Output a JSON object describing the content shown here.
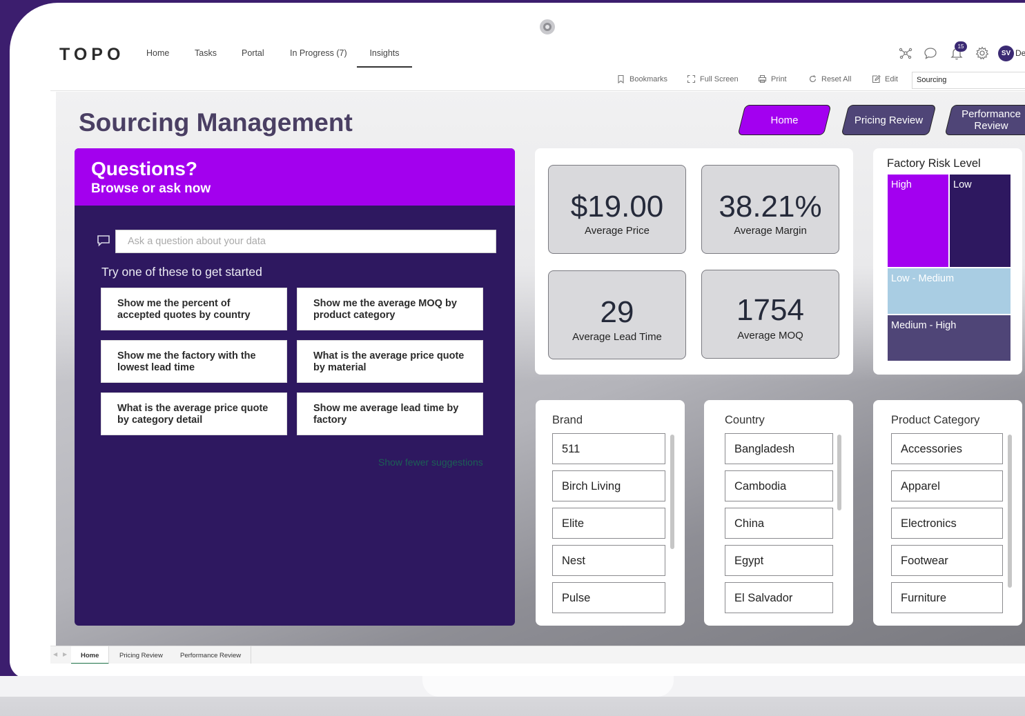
{
  "app": {
    "logo": "TOPO",
    "nav": [
      "Home",
      "Tasks",
      "Portal",
      "In Progress (7)",
      "Insights"
    ],
    "active_nav": "Insights",
    "notification_count": "15",
    "user_initials": "SV",
    "user_name_truncated": "De"
  },
  "toolbar": {
    "bookmarks": "Bookmarks",
    "full_screen": "Full Screen",
    "print": "Print",
    "reset_all": "Reset All",
    "edit": "Edit",
    "workspace": "Sourcing"
  },
  "report": {
    "title": "Sourcing Management",
    "nav_buttons": {
      "home": "Home",
      "pricing": "Pricing Review",
      "performance": "Performance Review"
    },
    "qa": {
      "title": "Questions?",
      "subtitle": "Browse or ask now",
      "input_placeholder": "Ask a question about your data",
      "try_label": "Try one of these to get started",
      "suggestions": [
        "Show me the percent of accepted quotes by country",
        "Show me the average MOQ by product category",
        "Show me the factory with the lowest lead time",
        "What is the average price quote by material",
        "What is the average price quote by category detail",
        "Show me average lead time by factory"
      ],
      "show_fewer": "Show fewer suggestions"
    },
    "kpis": [
      {
        "value": "$19.00",
        "label": "Average Price"
      },
      {
        "value": "38.21%",
        "label": "Average Margin"
      },
      {
        "value": "29",
        "label": "Average Lead Time"
      },
      {
        "value": "1754",
        "label": "Average MOQ"
      }
    ],
    "risk": {
      "title": "Factory Risk Level",
      "levels": [
        "High",
        "Low",
        "Low - Medium",
        "Medium - High"
      ],
      "colors": {
        "High": "#a300f0",
        "Low": "#2e1860",
        "Low - Medium": "#a9cde3",
        "Medium - High": "#4f4577"
      }
    },
    "slicers": {
      "brand": {
        "title": "Brand",
        "items": [
          "511",
          "Birch Living",
          "Elite",
          "Nest",
          "Pulse"
        ]
      },
      "country": {
        "title": "Country",
        "items": [
          "Bangladesh",
          "Cambodia",
          "China",
          "Egypt",
          "El Salvador"
        ]
      },
      "category": {
        "title": "Product Category",
        "items": [
          "Accessories",
          "Apparel",
          "Electronics",
          "Footwear",
          "Furniture"
        ]
      }
    }
  },
  "page_tabs": [
    "Home",
    "Pricing Review",
    "Performance Review"
  ],
  "colors": {
    "accent": "#a300f0",
    "panel": "#2e1860",
    "frame": "#3c1e6e"
  }
}
